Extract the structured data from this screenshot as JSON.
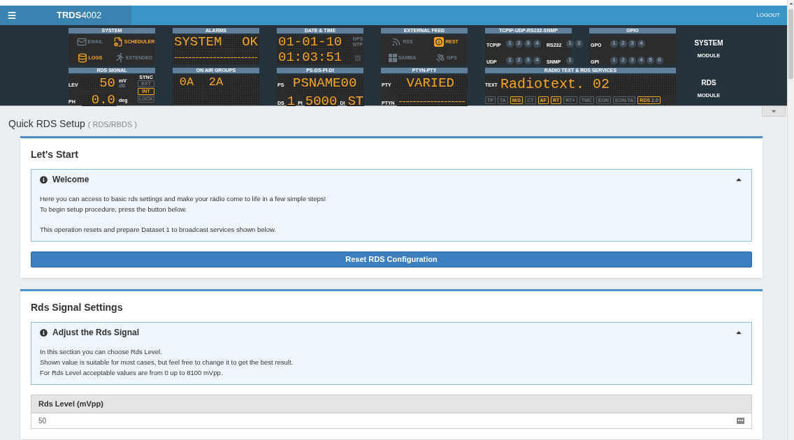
{
  "navbar": {
    "brand": "**TRDS**4002",
    "logout": "LOGOUT"
  },
  "dashboard": [
    {
      "module": {
        "name": "SYSTEM",
        "sub": "MODULE"
      },
      "panels": [
        {
          "title": "SYSTEM",
          "kind": "links",
          "items": [
            {
              "label": "EMAIL",
              "active": false
            },
            {
              "label": "SCHEDULER",
              "active": true
            },
            {
              "label": "LOGS",
              "active": true
            },
            {
              "label": "EXTENDED",
              "active": false
            }
          ]
        },
        {
          "title": "ALARMS",
          "kind": "display",
          "lines": [
            {
              "kind": "text",
              "parts": [
                "SYSTEM",
                "OK"
              ]
            },
            {
              "kind": "dashes"
            }
          ]
        },
        {
          "title": "DATE & TIME",
          "kind": "display",
          "lines": [
            {
              "kind": "text",
              "parts": [
                "01-01-10"
              ],
              "side": [
                "GPS",
                "NTP"
              ]
            },
            {
              "kind": "alarm_text",
              "parts": [
                "01:03:51"
              ]
            }
          ]
        },
        {
          "title": "EXTERNAL FEED",
          "kind": "links",
          "items": [
            {
              "label": "RSS",
              "active": false
            },
            {
              "label": "REST",
              "active": true
            },
            {
              "label": "SAMBA",
              "active": false
            },
            {
              "label": "GPS",
              "active": false
            }
          ]
        },
        {
          "title": "TCPIP-UDP-RS232-SNMP",
          "kind": "channels",
          "groups": [
            {
              "label": "TCPIP",
              "channels": [
                "1",
                "2",
                "3",
                "4"
              ]
            },
            {
              "label": "RS232",
              "channels": [
                "1",
                "2"
              ]
            },
            {
              "label": "UDP",
              "channels": [
                "1",
                "2",
                "3",
                "4"
              ]
            },
            {
              "label": "SNMP",
              "channels": [
                "1"
              ]
            }
          ]
        },
        {
          "title": "GPIO",
          "kind": "channels",
          "groups": [
            {
              "label": "GPO",
              "channels": [
                "1",
                "2",
                "3",
                "4"
              ]
            },
            {
              "label": "GPI",
              "channels": [
                "1",
                "2",
                "3",
                "4",
                "5",
                "6"
              ]
            }
          ]
        }
      ]
    },
    {
      "module": {
        "name": "RDS",
        "sub": "MODULE"
      },
      "panels": [
        {
          "title": "RDS SIGNAL",
          "kind": "signal",
          "readings": [
            {
              "label": "LEV",
              "value": "50",
              "unit": "mV",
              "alt_unit": "dB"
            },
            {
              "label": "PH",
              "value": "0.0",
              "unit": "deg"
            }
          ],
          "sync": {
            "label": "SYNC",
            "options": [
              {
                "label": "EXT",
                "selected": false
              },
              {
                "label": "INT",
                "selected": true
              },
              {
                "label": "LOCK",
                "selected": false
              }
            ]
          }
        },
        {
          "title": "ON AIR GROUPS",
          "kind": "groups",
          "groups": [
            "0A",
            "2A"
          ]
        },
        {
          "title": "PS-DS-PI-DI",
          "kind": "fields",
          "rows": [
            [
              {
                "label": "PS",
                "value": "PSNAME00"
              }
            ],
            [
              {
                "label": "DS",
                "value": "1"
              },
              {
                "label": "PI",
                "value": "5000"
              },
              {
                "label": "DI",
                "value": "ST"
              }
            ]
          ]
        },
        {
          "title": "PTYN-PTY",
          "kind": "fields",
          "rows": [
            [
              {
                "label": "PTY",
                "value": "VARIED"
              }
            ],
            [
              {
                "label": "PTYN",
                "kind": "dashes"
              }
            ]
          ]
        },
        {
          "title": "RADIO TEXT & RDS SERVICES",
          "kind": "radiotext",
          "label": "TEXT",
          "value": "Radiotext. 02",
          "services": [
            {
              "label": "TP",
              "on": false
            },
            {
              "label": "TA",
              "on": false
            },
            {
              "label": "M/S",
              "on": true
            },
            {
              "label": "CT",
              "on": false
            },
            {
              "label": "AF",
              "on": true
            },
            {
              "label": "RT",
              "on": true
            },
            {
              "label": "RT+",
              "on": false
            },
            {
              "label": "TMC",
              "on": false
            },
            {
              "label": "EON",
              "on": false
            },
            {
              "label": "EON-TA",
              "on": false
            },
            {
              "label": "RDS",
              "suffix": "2.0",
              "on": true
            }
          ]
        }
      ]
    }
  ],
  "page": {
    "title": "Quick RDS Setup",
    "subtitle": "( RDS/RBDS )",
    "dashboard_expanded": false
  },
  "sections": [
    {
      "title": "Let's Start",
      "info": {
        "title": "Welcome",
        "expanded": true,
        "paragraphs": [
          [
            "Here you can access to basic rds settings and make your radio come to life in a few simple steps!",
            "To begin setup procedure, press the button below."
          ],
          [
            "This operation resets and prepare Dataset 1 to broadcast services shown below."
          ]
        ]
      },
      "button": "Reset RDS Configuration"
    },
    {
      "title": "Rds Signal Settings",
      "info": {
        "title": "Adjust the Rds Signal",
        "expanded": true,
        "paragraphs": [
          [
            "In this section you can choose Rds Level.",
            "Shown value is suitable for most cases, but feel free to change it to get the best result.",
            "For Rds Level acceptable values are from 0 up to 8100 mVpp."
          ]
        ]
      },
      "field": {
        "label": "Rds Level (mVpp)",
        "value": "50"
      }
    }
  ]
}
